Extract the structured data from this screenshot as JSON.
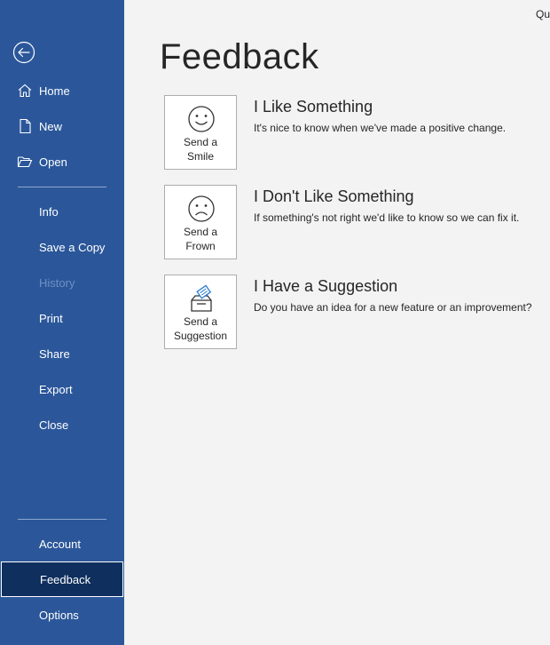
{
  "sidebar": {
    "back_label": "Back",
    "items": [
      {
        "label": "Home"
      },
      {
        "label": "New"
      },
      {
        "label": "Open"
      },
      {
        "label": "Info"
      },
      {
        "label": "Save a Copy"
      },
      {
        "label": "History"
      },
      {
        "label": "Print"
      },
      {
        "label": "Share"
      },
      {
        "label": "Export"
      },
      {
        "label": "Close"
      },
      {
        "label": "Account"
      },
      {
        "label": "Feedback"
      },
      {
        "label": "Options"
      }
    ],
    "selected": "Feedback",
    "disabled": [
      "History"
    ],
    "colors": {
      "background": "#2b579a",
      "selected": "#0f2f5e"
    }
  },
  "header": {
    "top_right_text": "Qu"
  },
  "main": {
    "title": "Feedback",
    "options": [
      {
        "card_line1": "Send a",
        "card_line2": "Smile",
        "heading": "I Like Something",
        "description": "It's nice to know when we've made a positive change.",
        "icon": "smile-icon"
      },
      {
        "card_line1": "Send a",
        "card_line2": "Frown",
        "heading": "I Don't Like Something",
        "description": "If something's not right we'd like to know so we can fix it.",
        "icon": "frown-icon"
      },
      {
        "card_line1": "Send a",
        "card_line2": "Suggestion",
        "heading": "I Have a Suggestion",
        "description": "Do you have an idea for a new feature or an improvement?",
        "icon": "suggestion-box-icon"
      }
    ]
  }
}
